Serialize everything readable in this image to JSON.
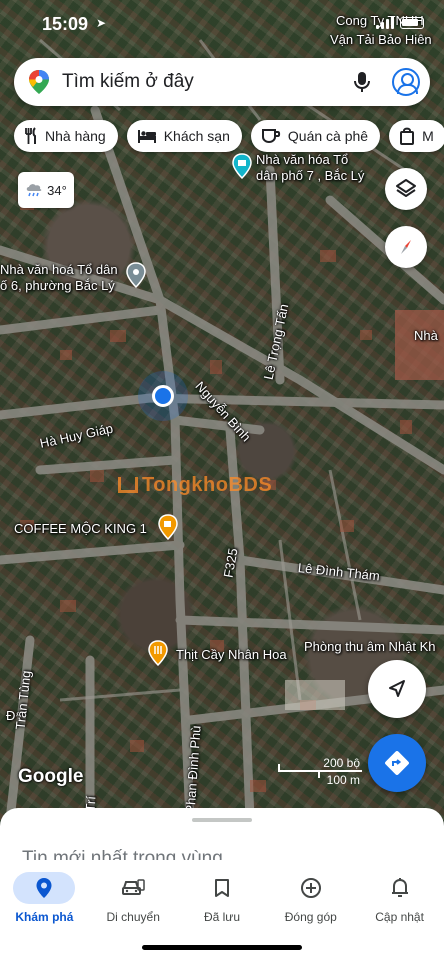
{
  "status_bar": {
    "time": "15:09",
    "carrier_label": "Cong Ty TNHH"
  },
  "search": {
    "placeholder": "Tìm kiếm ở đây"
  },
  "chips": [
    {
      "label": "Nhà hàng",
      "icon": "fork-knife-icon"
    },
    {
      "label": "Khách sạn",
      "icon": "bed-icon"
    },
    {
      "label": "Quán cà phê",
      "icon": "coffee-cup-icon"
    },
    {
      "label": "M",
      "icon": "shopping-bag-icon"
    }
  ],
  "weather": {
    "temperature": "34°",
    "icon": "rain-cloud-icon"
  },
  "map_labels": {
    "van_tai": "Vận Tải Bảo Hiên",
    "nha_van_hoa_7": "Nhà văn hóa Tổ",
    "nha_van_hoa_7_line2": "dân phố 7 , Bắc Lý",
    "nha_van_hoa_6": "Nhà văn hoá Tổ dân",
    "nha_van_hoa_6_line2": "ố 6, phường Bắc Lý",
    "nha_right": "Nhà",
    "le_trong_tan": "Lê Trọng Tấn",
    "nguyen_binh": "Nguyễn Bình",
    "ha_huy_giap": "Hà Huy Giáp",
    "coffee": "COFFEE MỘC KING 1",
    "f325": "F325",
    "le_dinh_tham": "Lê Đình Thám",
    "phong_thu_am": "Phòng thu âm Nhật Kh",
    "thit_cay": "Thịt Cầy Nhân Hoa",
    "tran_tung": "Trần Tùng",
    "phan_dinh_phung": "Phan Đình Phù",
    "d_label": "Đ",
    "tri": "Trí"
  },
  "watermark": "TongkhoBDS",
  "google_logo": "Google",
  "scale": {
    "feet": "200 bộ",
    "meters": "100 m"
  },
  "sheet": {
    "title": "Tin mới nhất trong vùng..."
  },
  "nav": [
    {
      "label": "Khám phá",
      "icon": "location-pin-icon",
      "active": true
    },
    {
      "label": "Di chuyển",
      "icon": "car-icon"
    },
    {
      "label": "Đã lưu",
      "icon": "bookmark-icon"
    },
    {
      "label": "Đóng góp",
      "icon": "add-circle-icon"
    },
    {
      "label": "Cập nhật",
      "icon": "bell-icon"
    }
  ],
  "colors": {
    "accent": "#1a73e8",
    "active_nav_bg": "#d3e3fd"
  }
}
